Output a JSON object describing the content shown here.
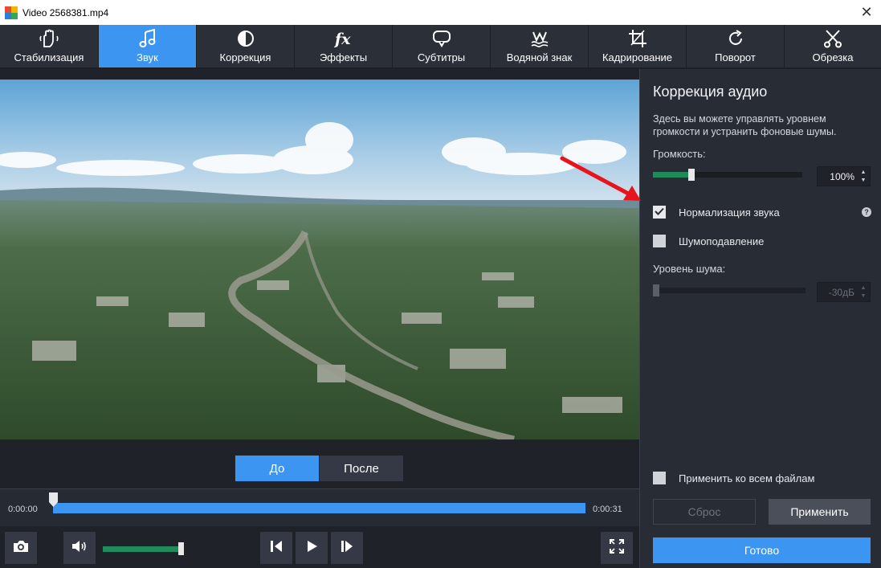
{
  "window": {
    "title": "Video 2568381.mp4",
    "close_glyph": "✕"
  },
  "tabs": [
    {
      "label": "Стабилизация",
      "icon": "stabilization-hand-icon"
    },
    {
      "label": "Звук",
      "icon": "music-note-icon",
      "active": true
    },
    {
      "label": "Коррекция",
      "icon": "color-correction-icon"
    },
    {
      "label": "Эффекты",
      "icon": "fx-icon"
    },
    {
      "label": "Субтитры",
      "icon": "speech-bubble-icon"
    },
    {
      "label": "Водяной знак",
      "icon": "watermark-icon"
    },
    {
      "label": "Кадрирование",
      "icon": "crop-icon"
    },
    {
      "label": "Поворот",
      "icon": "rotate-icon"
    },
    {
      "label": "Обрезка",
      "icon": "scissors-icon"
    }
  ],
  "preview": {
    "before_label": "До",
    "after_label": "После",
    "time_start": "0:00:00",
    "time_end": "0:00:31",
    "playhead_fraction": 0.0,
    "player_volume_fraction": 0.95
  },
  "panel": {
    "title": "Коррекция аудио",
    "description": "Здесь вы можете управлять уровнем громкости и устранить фоновые шумы.",
    "volume": {
      "label": "Громкость:",
      "value": "100%",
      "fraction": 0.25
    },
    "normalize": {
      "label": "Нормализация звука",
      "checked": true,
      "help_glyph": "?"
    },
    "denoise": {
      "label": "Шумоподавление",
      "checked": false
    },
    "noise_level": {
      "label": "Уровень шума:",
      "value": "-30дБ",
      "fraction": 0.0
    },
    "apply_all": {
      "label": "Применить ко всем файлам",
      "checked": false
    },
    "reset_label": "Сброс",
    "apply_label": "Применить",
    "done_label": "Готово"
  },
  "colors": {
    "accent": "#3d95f2",
    "slider_green": "#1f8a5a",
    "annotation_arrow": "#e8141c"
  }
}
